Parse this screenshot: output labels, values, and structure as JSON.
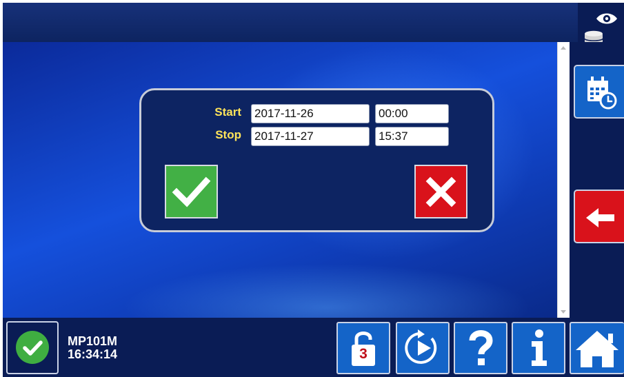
{
  "dialog": {
    "start_label": "Start",
    "stop_label": "Stop",
    "start_date": "2017-11-26",
    "start_time": "00:00",
    "stop_date": "2017-11-27",
    "stop_time": "15:37"
  },
  "status": {
    "machine_name": "MP101M",
    "time": "16:34:14"
  },
  "toolbar": {
    "access_level": "3"
  },
  "colors": {
    "accent_blue": "#1464c8",
    "confirm_green": "#42b045",
    "cancel_red": "#d9121b",
    "label_yellow": "#ffe45a"
  },
  "icons": {
    "top_right": [
      "eye-icon",
      "database-icon"
    ],
    "side": [
      "calendar-clock-icon",
      "arrow-left-icon"
    ],
    "bottom": [
      "check-circle-icon",
      "unlock-icon",
      "play-cycle-icon",
      "help-icon",
      "info-icon",
      "home-icon"
    ],
    "dialog": [
      "check-icon",
      "close-icon"
    ]
  }
}
